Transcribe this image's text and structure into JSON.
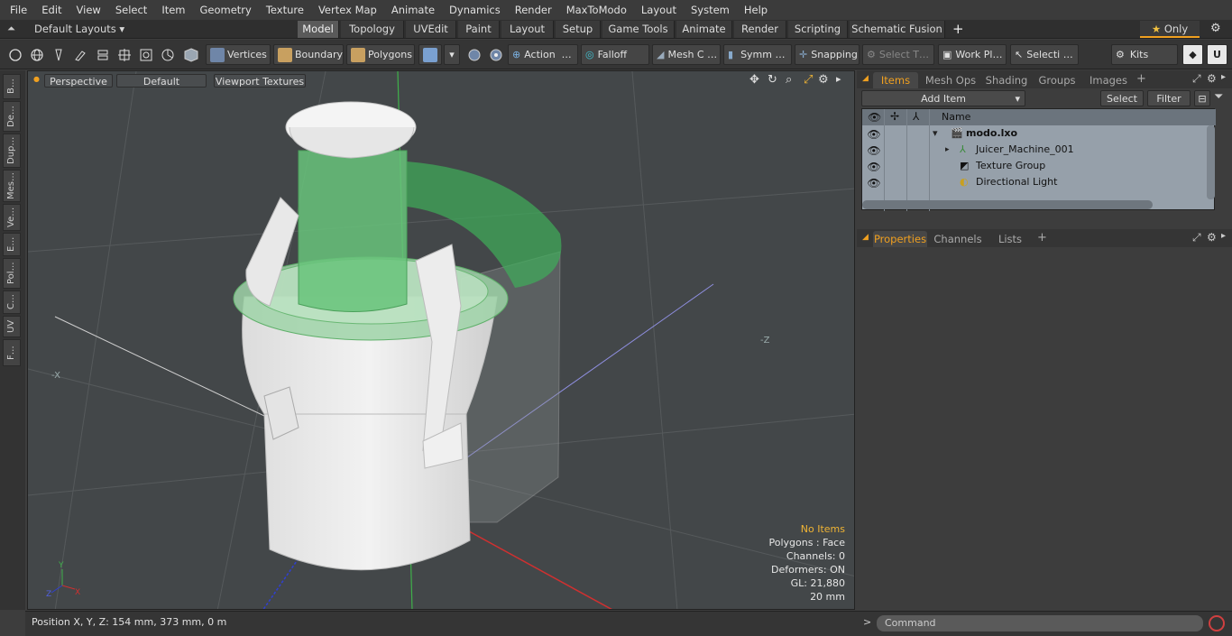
{
  "menu": [
    "File",
    "Edit",
    "View",
    "Select",
    "Item",
    "Geometry",
    "Texture",
    "Vertex Map",
    "Animate",
    "Dynamics",
    "Render",
    "MaxToModo",
    "Layout",
    "System",
    "Help"
  ],
  "layout": {
    "dropdown": "Default Layouts",
    "tabs": [
      "Model",
      "Topology",
      "UVEdit",
      "Paint",
      "Layout",
      "Setup",
      "Game Tools",
      "Animate",
      "Render",
      "Scripting",
      "Schematic Fusion"
    ],
    "active_tab": "Model",
    "add": "+",
    "only": "Only",
    "star": "★"
  },
  "toolbar": {
    "vertices": "Vertices",
    "boundary": "Boundary",
    "polygons": "Polygons",
    "action": "Action",
    "action_more": "…",
    "falloff": "Falloff",
    "mesh": "Mesh C …",
    "symm": "Symm …",
    "snapping": "Snapping",
    "select_t": "Select T…",
    "work_pl": "Work Pl…",
    "selecti": "Selecti …",
    "kits": "Kits"
  },
  "left_tabs": [
    "B…",
    "De…",
    "Dup…",
    "Mes…",
    "Ve…",
    "E…",
    "Pol…",
    "C…",
    "UV",
    "F…"
  ],
  "viewport": {
    "perspective": "Perspective",
    "default": "Default",
    "textures": "Viewport Textures",
    "info": {
      "no_items": "No Items",
      "polygons": "Polygons : Face",
      "channels": "Channels: 0",
      "deformers": "Deformers: ON",
      "gl": "GL: 21,880",
      "scale": "20 mm"
    },
    "axis_labels": {
      "neg_x": "-X",
      "neg_z": "-Z"
    }
  },
  "status": {
    "position": "Position X, Y, Z:   154 mm, 373 mm, 0 m"
  },
  "items_panel": {
    "tabs": [
      "Items",
      "Mesh Ops",
      "Shading",
      "Groups",
      "Images"
    ],
    "active_tab": "Items",
    "add_item": "Add Item",
    "select": "Select",
    "filter": "Filter",
    "col_name": "Name",
    "rows": [
      {
        "name": "modo.lxo",
        "bold": true
      },
      {
        "name": "Juicer_Machine_001",
        "bold": false
      },
      {
        "name": "Texture Group",
        "bold": false
      },
      {
        "name": "Directional Light",
        "bold": false
      }
    ]
  },
  "props_panel": {
    "tabs": [
      "Properties",
      "Channels",
      "Lists"
    ],
    "active_tab": "Properties",
    "add": "+"
  },
  "command": {
    "placeholder": "Command",
    "prompt": ">"
  },
  "colors": {
    "accent": "#f0a020",
    "warn": "#f0b434",
    "selection_green": "#3fae5a"
  }
}
